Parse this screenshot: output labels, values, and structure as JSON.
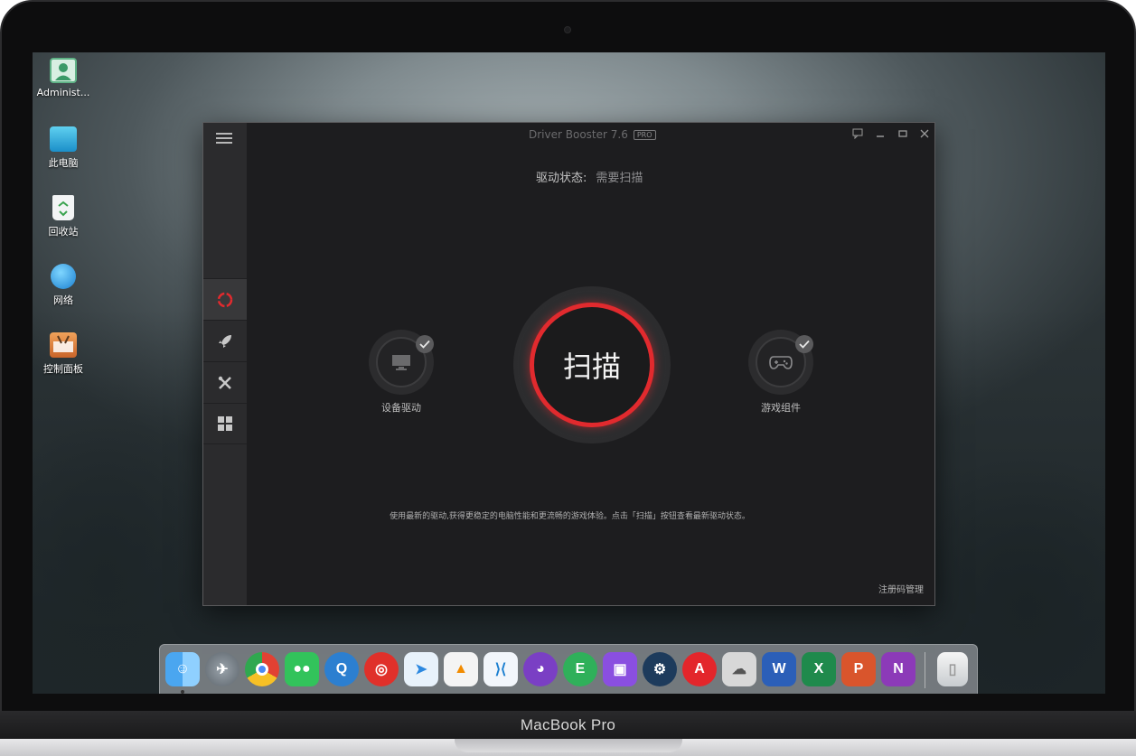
{
  "device": {
    "brand_label": "MacBook Pro"
  },
  "desktop": {
    "icons": [
      {
        "label": "Administ...",
        "icon": "user-account-icon"
      },
      {
        "label": "此电脑",
        "icon": "computer-icon"
      },
      {
        "label": "回收站",
        "icon": "recycle-bin-icon"
      },
      {
        "label": "网络",
        "icon": "network-globe-icon"
      },
      {
        "label": "控制面板",
        "icon": "control-panel-icon"
      }
    ]
  },
  "app": {
    "title": "Driver Booster 7.6",
    "edition_badge": "PRO",
    "status": {
      "label": "驱动状态:",
      "value": "需要扫描"
    },
    "scan_button_label": "扫描",
    "features": [
      {
        "label": "设备驱动",
        "icon": "monitor-icon",
        "checked": true
      },
      {
        "label": "游戏组件",
        "icon": "gamepad-icon",
        "checked": true
      }
    ],
    "description": "使用最新的驱动,获得更稳定的电脑性能和更流畅的游戏体验。点击「扫描」按钮查看最新驱动状态。",
    "bottom_link": "注册码管理",
    "sidebar_tabs": [
      {
        "icon": "scan-refresh-icon",
        "active": true
      },
      {
        "icon": "rocket-boost-icon",
        "active": false
      },
      {
        "icon": "tools-icon",
        "active": false
      },
      {
        "icon": "action-center-grid-icon",
        "active": false
      }
    ],
    "window_controls": [
      "feedback-icon",
      "minimize-icon",
      "maximize-icon",
      "close-icon"
    ],
    "colors": {
      "accent": "#e12a2e",
      "background": "#1d1d1f",
      "sidebar": "#2b2b2d"
    }
  },
  "dock": {
    "items": [
      "finder-icon",
      "launchpad-icon",
      "chrome-icon",
      "wechat-icon",
      "qq-icon",
      "netease-music-icon",
      "feishu-icon",
      "vlc-icon",
      "vscode-icon",
      "github-icon",
      "evernote-icon",
      "twitch-icon",
      "steam-icon",
      "adobe-reader-icon",
      "cloud-app-icon",
      "word-icon",
      "excel-icon",
      "powerpoint-icon",
      "onenote-icon",
      "trash-icon"
    ]
  }
}
